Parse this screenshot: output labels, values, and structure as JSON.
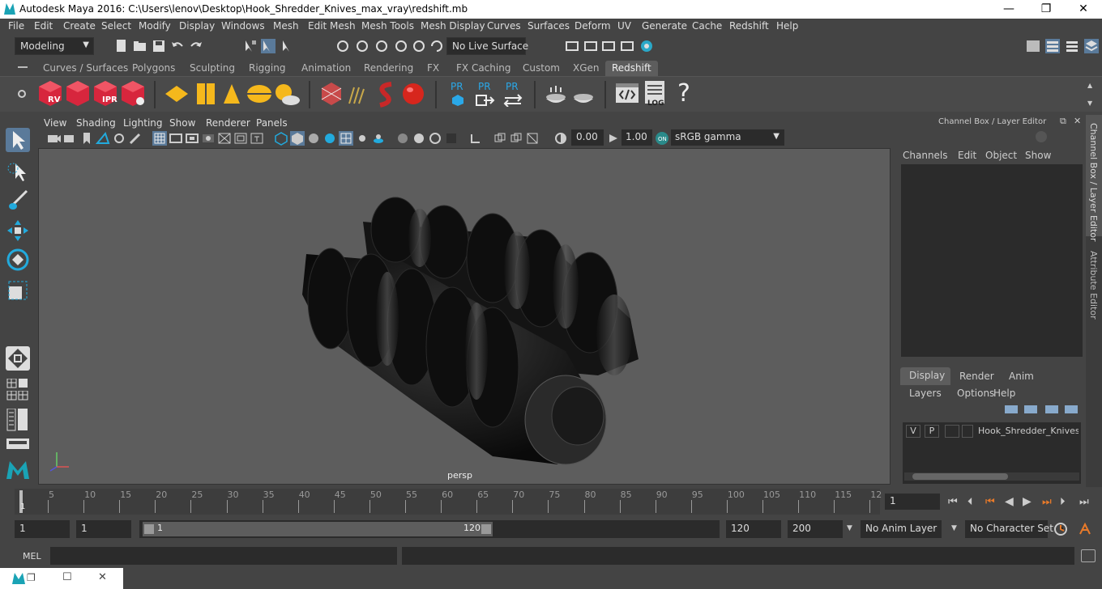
{
  "window": {
    "title": "Autodesk Maya 2016: C:\\Users\\lenov\\Desktop\\Hook_Shredder_Knives_max_vray\\redshift.mb",
    "min": "—",
    "max": "❐",
    "close": "✕"
  },
  "menu": [
    "File",
    "Edit",
    "Create",
    "Select",
    "Modify",
    "Display",
    "Windows",
    "Mesh",
    "Edit Mesh",
    "Mesh Tools",
    "Mesh Display",
    "Curves",
    "Surfaces",
    "Deform",
    "UV",
    "Generate",
    "Cache",
    "Redshift",
    "Help"
  ],
  "status": {
    "mode": "Modeling",
    "live_surface": "No Live Surface"
  },
  "shelf_tabs": [
    "Curves / Surfaces",
    "Polygons",
    "Sculpting",
    "Rigging",
    "Animation",
    "Rendering",
    "FX",
    "FX Caching",
    "Custom",
    "XGen",
    "Redshift"
  ],
  "shelf_active": "Redshift",
  "shelf_labels": {
    "rv": "RV",
    "ipr": "IPR",
    "pr1": "PR",
    "pr2": "PR",
    "pr3": "PR",
    "log": "LOG",
    "help": "?"
  },
  "panel_menu": [
    "View",
    "Shading",
    "Lighting",
    "Show",
    "Renderer",
    "Panels"
  ],
  "panel_fields": {
    "exposure": "0.00",
    "gamma": "1.00",
    "colorspace": "sRGB gamma"
  },
  "viewport": {
    "camera": "persp"
  },
  "channel_box": {
    "title": "Channel Box / Layer Editor",
    "menu": [
      "Channels",
      "Edit",
      "Object",
      "Show"
    ]
  },
  "layer_tabs": [
    "Display",
    "Render",
    "Anim"
  ],
  "layer_menu": [
    "Layers",
    "Options",
    "Help"
  ],
  "layer": {
    "v": "V",
    "p": "P",
    "name": "Hook_Shredder_Knives_("
  },
  "side_tabs": [
    "Channel Box / Layer Editor",
    "Attribute Editor"
  ],
  "timeline": {
    "ticks": [
      "5",
      "10",
      "15",
      "20",
      "25",
      "30",
      "35",
      "40",
      "45",
      "50",
      "55",
      "60",
      "65",
      "70",
      "75",
      "80",
      "85",
      "90",
      "95",
      "100",
      "105",
      "110",
      "115",
      "12"
    ],
    "current_marker": "1",
    "current_frame": "1"
  },
  "range": {
    "start": "1",
    "start2": "1",
    "slider_start": "1",
    "slider_end": "120",
    "end": "120",
    "end2": "200",
    "anim_layer": "No Anim Layer",
    "char_set": "No Character Set"
  },
  "cmd": {
    "label": "MEL"
  }
}
